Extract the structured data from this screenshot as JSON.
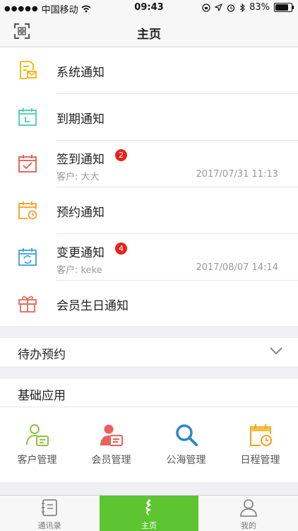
{
  "status_bar": {
    "carrier": "中国移动",
    "time": "09:43",
    "battery": "83%"
  },
  "nav": {
    "title": "主页"
  },
  "notices": [
    {
      "label": "系统通知"
    },
    {
      "label": "到期通知"
    },
    {
      "label": "签到通知",
      "badge": "2",
      "sub": "客户: 大大",
      "time": "2017/07/31 11:13"
    },
    {
      "label": "预约通知"
    },
    {
      "label": "变更通知",
      "badge": "4",
      "sub": "客户: keke",
      "time": "2017/08/07 14:14"
    },
    {
      "label": "会员生日通知"
    }
  ],
  "pending": {
    "label": "待办预约"
  },
  "apps": {
    "header": "基础应用",
    "items": [
      {
        "label": "客户管理",
        "icon": "customer-icon"
      },
      {
        "label": "会员管理",
        "icon": "member-icon"
      },
      {
        "label": "公海管理",
        "icon": "search-icon"
      },
      {
        "label": "日程管理",
        "icon": "schedule-icon"
      }
    ]
  },
  "tabs": [
    {
      "label": "通讯录",
      "icon": "contacts-icon"
    },
    {
      "label": "主页",
      "icon": "home-icon"
    },
    {
      "label": "我的",
      "icon": "profile-icon"
    }
  ],
  "colors": {
    "accent": "#5dc531",
    "badge": "#e5241d"
  }
}
